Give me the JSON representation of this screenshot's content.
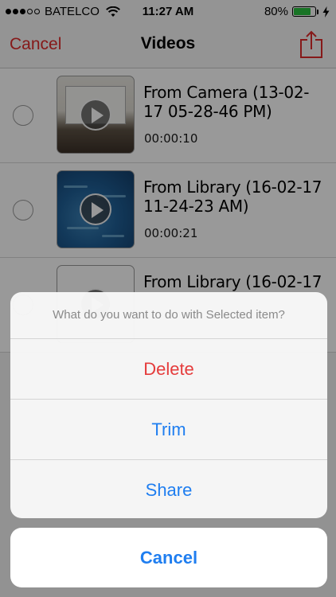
{
  "status_bar": {
    "carrier": "BATELCO",
    "time": "11:27 AM",
    "battery_percent": "80%",
    "battery_level": 0.8,
    "signal_bars_filled": 3,
    "signal_bars_total": 5
  },
  "nav": {
    "cancel_label": "Cancel",
    "title": "Videos",
    "share_icon": "share-icon",
    "accent_color": "#e02a2a"
  },
  "videos": [
    {
      "title": "From Camera (13-02-17 05-28-46 PM)",
      "duration": "00:00:10"
    },
    {
      "title": "From Library (16-02-17 11-24-23 AM)",
      "duration": "00:00:21"
    },
    {
      "title": "From Library (16-02-17",
      "duration": ""
    }
  ],
  "action_sheet": {
    "message": "What do you want to do with Selected item?",
    "buttons": [
      {
        "label": "Delete",
        "style": "destructive"
      },
      {
        "label": "Trim",
        "style": "default"
      },
      {
        "label": "Share",
        "style": "default"
      }
    ],
    "cancel_label": "Cancel",
    "destructive_color": "#e53c3c",
    "action_color": "#1f7ef0"
  }
}
